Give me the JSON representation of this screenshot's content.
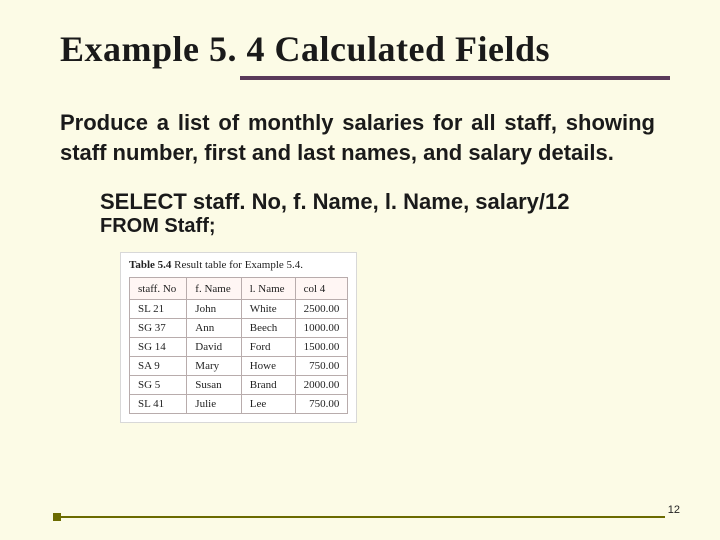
{
  "title": "Example 5. 4  Calculated Fields",
  "description": "Produce a list of monthly salaries for all staff, showing staff number, first and last names, and  salary details.",
  "sql": {
    "line1": "SELECT staff. No, f. Name, l. Name, salary/12",
    "line2": "FROM Staff;"
  },
  "table": {
    "caption_bold": "Table 5.4",
    "caption_rest": "  Result table for Example 5.4.",
    "headers": [
      "staff. No",
      "f. Name",
      "l. Name",
      "col 4"
    ],
    "rows": [
      [
        "SL 21",
        "John",
        "White",
        "2500.00"
      ],
      [
        "SG 37",
        "Ann",
        "Beech",
        "1000.00"
      ],
      [
        "SG 14",
        "David",
        "Ford",
        "1500.00"
      ],
      [
        "SA 9",
        "Mary",
        "Howe",
        "750.00"
      ],
      [
        "SG 5",
        "Susan",
        "Brand",
        "2000.00"
      ],
      [
        "SL 41",
        "Julie",
        "Lee",
        "750.00"
      ]
    ]
  },
  "page_number": "12",
  "chart_data": {
    "type": "table",
    "title": "Table 5.4  Result table for Example 5.4.",
    "columns": [
      "staff. No",
      "f. Name",
      "l. Name",
      "col 4"
    ],
    "rows": [
      {
        "staff_no": "SL 21",
        "f_name": "John",
        "l_name": "White",
        "col4": 2500.0
      },
      {
        "staff_no": "SG 37",
        "f_name": "Ann",
        "l_name": "Beech",
        "col4": 1000.0
      },
      {
        "staff_no": "SG 14",
        "f_name": "David",
        "l_name": "Ford",
        "col4": 1500.0
      },
      {
        "staff_no": "SA 9",
        "f_name": "Mary",
        "l_name": "Howe",
        "col4": 750.0
      },
      {
        "staff_no": "SG 5",
        "f_name": "Susan",
        "l_name": "Brand",
        "col4": 2000.0
      },
      {
        "staff_no": "SL 41",
        "f_name": "Julie",
        "l_name": "Lee",
        "col4": 750.0
      }
    ]
  }
}
